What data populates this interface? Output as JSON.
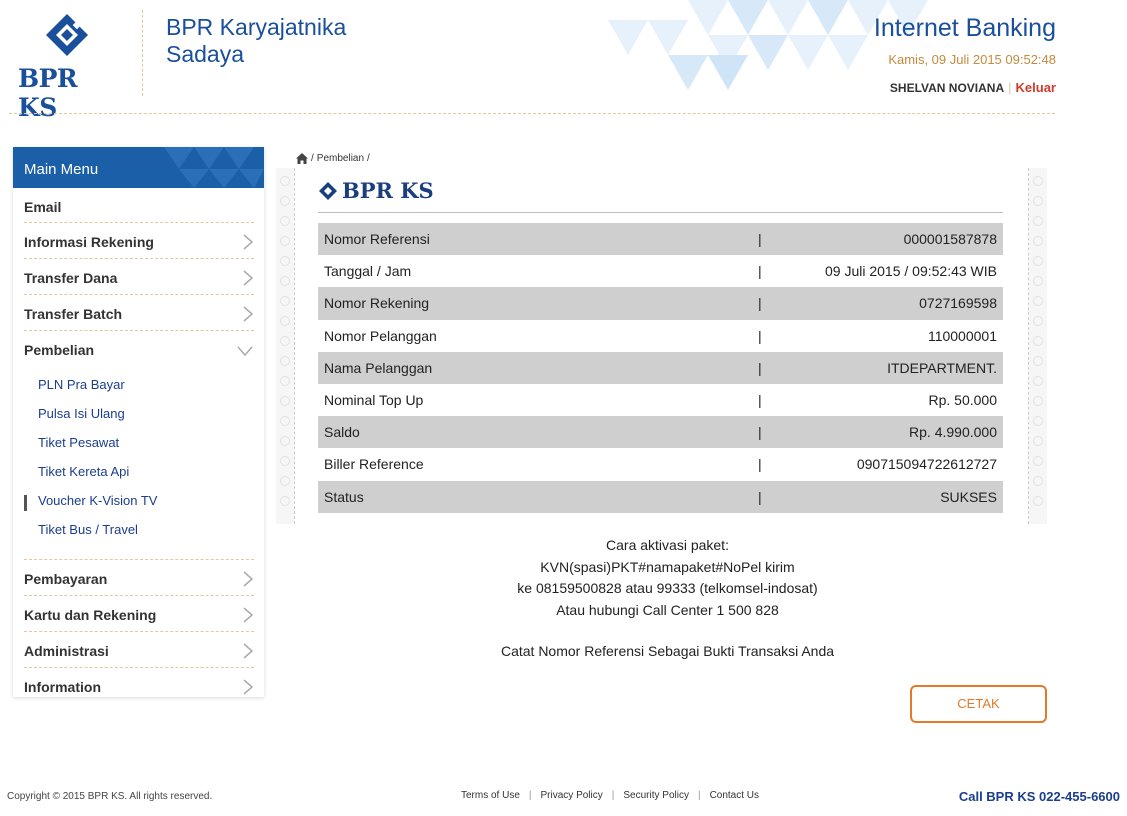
{
  "header": {
    "logo_text": "BPR KS",
    "bank_name": "BPR Karyajatnika Sadaya",
    "app_title": "Internet Banking",
    "datetime": "Kamis, 09 Juli 2015 09:52:48",
    "user_name": "SHELVAN NOVIANA",
    "separator": "|",
    "logout_label": "Keluar"
  },
  "sidebar": {
    "title": "Main Menu",
    "items_top": [
      {
        "label": "Email"
      },
      {
        "label": "Informasi Rekening"
      },
      {
        "label": "Transfer Dana"
      },
      {
        "label": "Transfer Batch"
      },
      {
        "label": "Pembelian"
      }
    ],
    "submenu": [
      {
        "label": "PLN Pra Bayar"
      },
      {
        "label": "Pulsa Isi Ulang"
      },
      {
        "label": "Tiket Pesawat"
      },
      {
        "label": "Tiket Kereta Api"
      },
      {
        "label": "Voucher K-Vision TV",
        "active": true
      },
      {
        "label": "Tiket Bus / Travel"
      }
    ],
    "items_bottom": [
      {
        "label": "Pembayaran"
      },
      {
        "label": "Kartu dan Rekening"
      },
      {
        "label": "Administrasi"
      },
      {
        "label": "Information"
      }
    ]
  },
  "breadcrumb": {
    "sep1": "/",
    "current": "Pembelian",
    "sep2": "/"
  },
  "receipt": {
    "logo_text": "BPR KS",
    "pipe": "|",
    "rows": [
      {
        "key": "Nomor Referensi",
        "value": "000001587878"
      },
      {
        "key": "Tanggal / Jam",
        "value": "09 Juli 2015 / 09:52:43 WIB"
      },
      {
        "key": "Nomor Rekening",
        "value": "0727169598"
      },
      {
        "key": "Nomor Pelanggan",
        "value": "110000001"
      },
      {
        "key": "Nama Pelanggan",
        "value": "ITDEPARTMENT."
      },
      {
        "key": "Nominal Top Up",
        "value": "Rp. 50.000"
      },
      {
        "key": "Saldo",
        "value": "Rp. 4.990.000"
      },
      {
        "key": "Biller Reference",
        "value": "090715094722612727"
      },
      {
        "key": "Status",
        "value": "SUKSES"
      }
    ]
  },
  "notes": {
    "line1": "Cara aktivasi paket:",
    "line2": "KVN(spasi)PKT#namapaket#NoPel kirim",
    "line3": "ke 08159500828 atau 99333 (telkomsel-indosat)",
    "line4": "Atau hubungi Call Center 1 500 828",
    "reminder": "Catat Nomor Referensi Sebagai Bukti Transaksi Anda"
  },
  "actions": {
    "print_label": "CETAK"
  },
  "footer": {
    "copyright": "Copyright © 2015 BPR KS. All rights reserved.",
    "links": [
      "Terms of Use",
      "Privacy Policy",
      "Security Policy",
      "Contact Us"
    ],
    "link_sep": "|",
    "call": "Call BPR KS 022-455-6600"
  },
  "colors": {
    "brand_blue": "#1a4f9c",
    "menu_header": "#1a5fa8",
    "accent_orange": "#e27a2a",
    "logout_red": "#d23b2a"
  }
}
